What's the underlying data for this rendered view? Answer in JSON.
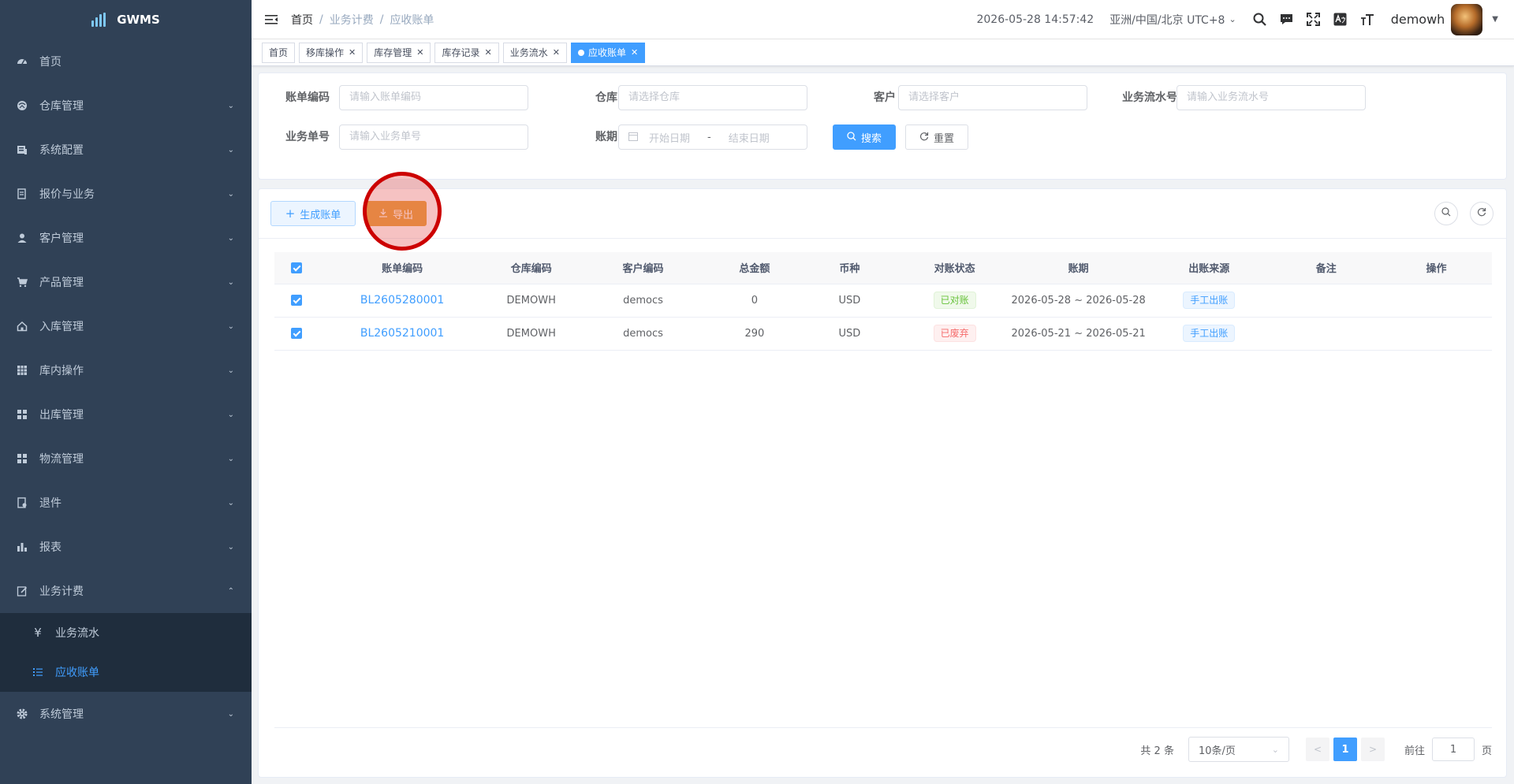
{
  "sidebar": {
    "logo_text": "GWMS",
    "menu": [
      {
        "label": "首页",
        "icon": "dashboard-icon"
      },
      {
        "label": "仓库管理",
        "icon": "warehouse-icon"
      },
      {
        "label": "系统配置",
        "icon": "config-icon"
      },
      {
        "label": "报价与业务",
        "icon": "quote-icon"
      },
      {
        "label": "客户管理",
        "icon": "user-icon"
      },
      {
        "label": "产品管理",
        "icon": "cart-icon"
      },
      {
        "label": "入库管理",
        "icon": "home-icon"
      },
      {
        "label": "库内操作",
        "icon": "grid-icon"
      },
      {
        "label": "出库管理",
        "icon": "apps-icon"
      },
      {
        "label": "物流管理",
        "icon": "apps-icon"
      },
      {
        "label": "退件",
        "icon": "return-icon"
      },
      {
        "label": "报表",
        "icon": "chart-icon"
      },
      {
        "label": "业务计费",
        "icon": "edit-icon"
      }
    ],
    "submenu": [
      {
        "label": "业务流水",
        "icon": "yen-icon"
      },
      {
        "label": "应收账单",
        "icon": "list-icon"
      }
    ],
    "last_menu": {
      "label": "系统管理",
      "icon": "gear-icon"
    }
  },
  "header": {
    "breadcrumb": [
      "首页",
      "业务计费",
      "应收账单"
    ],
    "datetime": "2026-05-28 14:57:42",
    "timezone": "亚洲/中国/北京 UTC+8",
    "username": "demowh"
  },
  "tags": [
    {
      "label": "首页",
      "closable": false,
      "active": false
    },
    {
      "label": "移库操作",
      "closable": true,
      "active": false
    },
    {
      "label": "库存管理",
      "closable": true,
      "active": false
    },
    {
      "label": "库存记录",
      "closable": true,
      "active": false
    },
    {
      "label": "业务流水",
      "closable": true,
      "active": false
    },
    {
      "label": "应收账单",
      "closable": true,
      "active": true
    }
  ],
  "search_form": {
    "bill_code_label": "账单编码",
    "bill_code_placeholder": "请输入账单编码",
    "warehouse_label": "仓库",
    "warehouse_placeholder": "请选择仓库",
    "customer_label": "客户",
    "customer_placeholder": "请选择客户",
    "flow_no_label": "业务流水号",
    "flow_no_placeholder": "请输入业务流水号",
    "business_no_label": "业务单号",
    "business_no_placeholder": "请输入业务单号",
    "period_label": "账期",
    "start_placeholder": "开始日期",
    "range_separator": "-",
    "end_placeholder": "结束日期",
    "search_button": "搜索",
    "reset_button": "重置"
  },
  "toolbar": {
    "generate_button": "生成账单",
    "export_button": "导出"
  },
  "table": {
    "columns": [
      "账单编码",
      "仓库编码",
      "客户编码",
      "总金额",
      "币种",
      "对账状态",
      "账期",
      "出账来源",
      "备注",
      "操作"
    ],
    "rows": [
      {
        "bill_code": "BL2605280001",
        "warehouse": "DEMOWH",
        "customer": "democs",
        "amount": "0",
        "currency": "USD",
        "status": "已对账",
        "status_type": "success",
        "period": "2026-05-28 ~ 2026-05-28",
        "source": "手工出账",
        "remark": "",
        "action": ""
      },
      {
        "bill_code": "BL2605210001",
        "warehouse": "DEMOWH",
        "customer": "democs",
        "amount": "290",
        "currency": "USD",
        "status": "已废弃",
        "status_type": "danger",
        "period": "2026-05-21 ~ 2026-05-21",
        "source": "手工出账",
        "remark": "",
        "action": ""
      }
    ]
  },
  "pagination": {
    "total_text": "共 2 条",
    "page_size": "10条/页",
    "current_page": "1",
    "goto_label": "前往",
    "goto_value": "1",
    "page_suffix": "页"
  },
  "colors": {
    "sidebar_bg": "#304156",
    "primary": "#409eff",
    "warning": "#e6a23c"
  }
}
